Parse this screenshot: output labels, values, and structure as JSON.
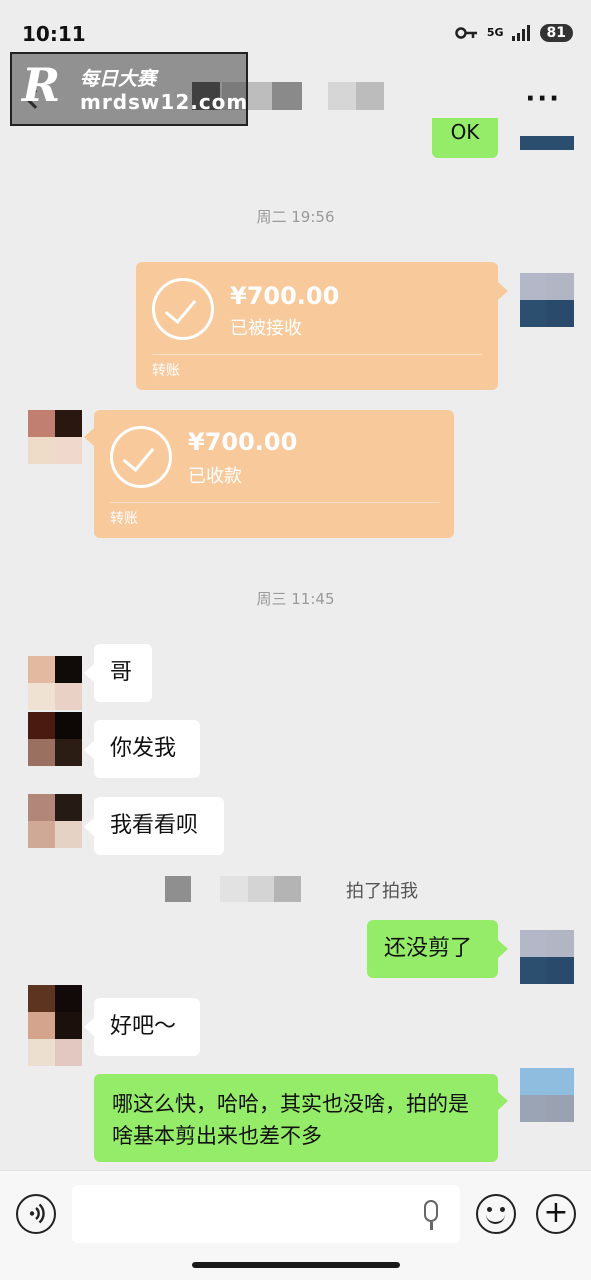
{
  "status_bar": {
    "time": "10:11",
    "network": "5G",
    "battery": "81"
  },
  "watermark": {
    "logo_letter": "R",
    "line1": "每日大赛",
    "line2": "mrdsw12.com"
  },
  "header": {
    "more": "···"
  },
  "partial_top_message": "OK",
  "timestamps": {
    "first": "周二 19:56",
    "second": "周三 11:45"
  },
  "transfers": [
    {
      "amount": "¥700.00",
      "status": "已被接收",
      "label": "转账"
    },
    {
      "amount": "¥700.00",
      "status": "已收款",
      "label": "转账"
    }
  ],
  "messages": {
    "m1": "哥",
    "m2": "你发我",
    "m3": "我看看呗",
    "m4": "还没剪了",
    "m5": "好吧～",
    "m6": "哪这么快，哈哈，其实也没啥，拍的是啥基本剪出来也差不多"
  },
  "pat_notice": {
    "text": "拍了拍我"
  },
  "colors": {
    "background": "#ededed",
    "sent_bubble": "#95ec69",
    "received_bubble": "#ffffff",
    "transfer_card": "#f8c99b"
  }
}
